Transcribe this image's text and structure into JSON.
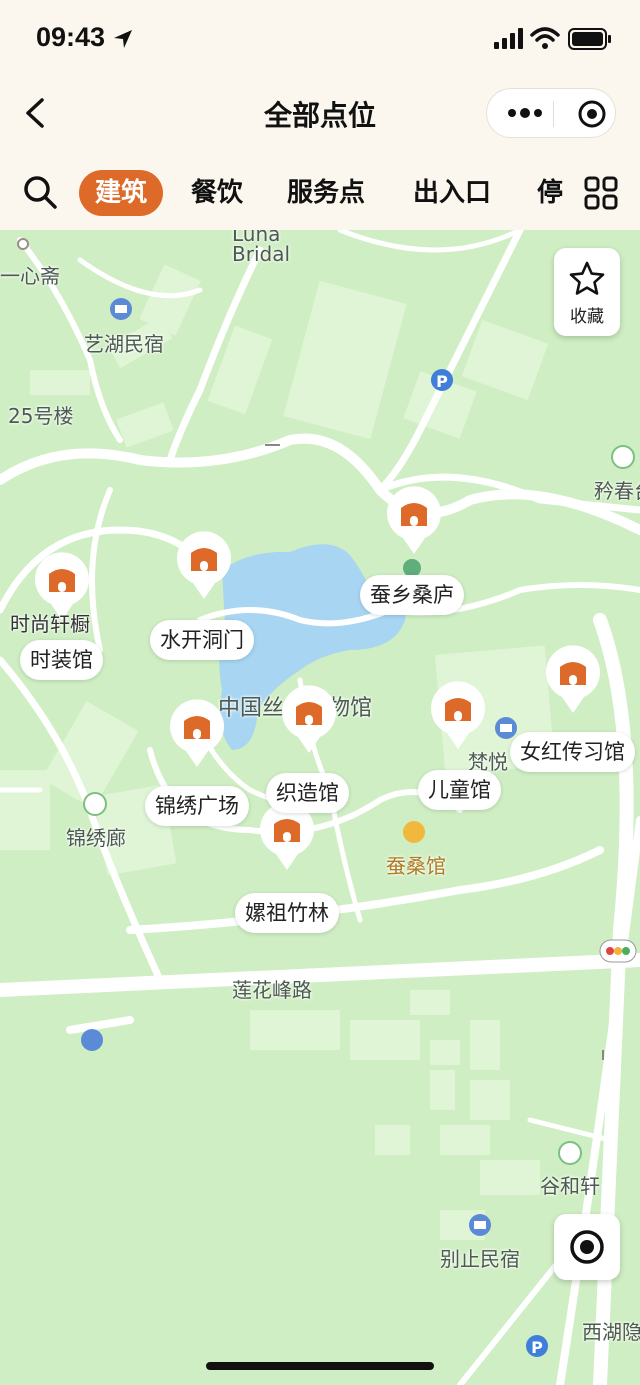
{
  "status_bar": {
    "time": "09:43"
  },
  "header": {
    "title": "全部点位"
  },
  "tabs": [
    {
      "label": "建筑",
      "active": true
    },
    {
      "label": "餐饮",
      "active": false
    },
    {
      "label": "服务点",
      "active": false
    },
    {
      "label": "出入口",
      "active": false
    },
    {
      "label": "停",
      "active": false
    }
  ],
  "favorite": {
    "label": "收藏"
  },
  "map_labels": {
    "luna_bridal": "Luna\nBridal",
    "yixinzhai": "一心斋",
    "yihu_minsu": "艺湖民宿",
    "building_25": "25号楼",
    "linchun": "矜春台",
    "museum": "中国丝绸博物馆",
    "fanyue": "梵悦",
    "jinxiulang": "锦绣廊",
    "cansangguan": "蚕桑馆",
    "lianhuafeng_road": "莲花峰路",
    "guhexuan": "谷和轩",
    "biezhi_minsu": "别止民宿",
    "xihu": "西湖隐"
  },
  "poi_labels": {
    "cansang_lu": "蚕乡桑庐",
    "shuikai_dongmen": "水开洞门",
    "shishang_chuchu": "时尚轩橱",
    "shizhuang_guan": "时装馆",
    "jinxiu_guangchang": "锦绣广场",
    "zhizao_guan": "织造馆",
    "ertong_guan": "儿童馆",
    "nuhong": "女红传习馆",
    "leizu_zhulin": "嫘祖竹林"
  },
  "colors": {
    "accent": "#de6a2a",
    "map_green": "#cfeec3",
    "water": "#a8d5f2",
    "road": "#ffffff"
  }
}
